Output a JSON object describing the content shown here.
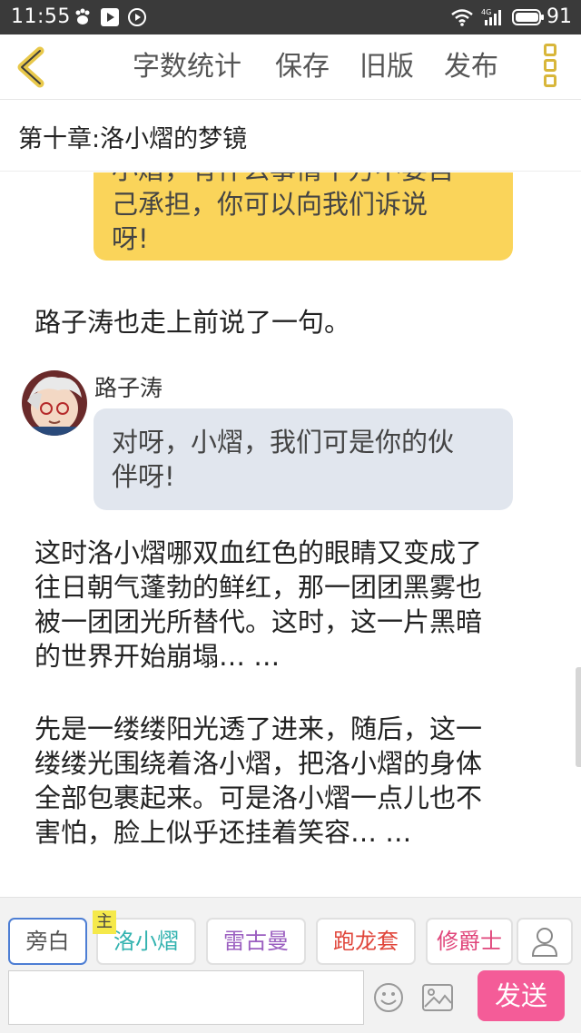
{
  "status_bar": {
    "time": "11:55",
    "network": "4G",
    "battery": "91"
  },
  "toolbar": {
    "word_count": "字数统计",
    "save": "保存",
    "old_version": "旧版",
    "publish": "发布"
  },
  "chapter": {
    "title": "第十章:洛小熠的梦镜"
  },
  "content": {
    "yellow_bubble": {
      "line1": "小熠，有什么事情千万不要自",
      "line2": "己承担，你可以向我们诉说",
      "line3": "呀!"
    },
    "para1": "路子涛也走上前说了一句。",
    "speaker": "路子涛",
    "grey_bubble": {
      "line1": "对呀，小熠，我们可是你的伙",
      "line2": "伴呀!"
    },
    "para2": {
      "line1": "这时洛小熠哪双血红色的眼睛又变成了",
      "line2": "往日朝气蓬勃的鲜红，那一团团黑雾也",
      "line3": "被一团团光所替代。这时，这一片黑暗",
      "line4": "的世界开始崩塌… …"
    },
    "para3": {
      "line1": "先是一缕缕阳光透了进来，随后，这一",
      "line2": "缕缕光围绕着洛小熠，把洛小熠的身体",
      "line3": "全部包裹起来。可是洛小熠一点儿也不",
      "line4": "害怕，脸上似乎还挂着笑容… …"
    }
  },
  "rolebar": {
    "roles": [
      {
        "label": "旁白",
        "color": "#555555"
      },
      {
        "label": "洛小熠",
        "color": "#33b3b0"
      },
      {
        "label": "雷古曼",
        "color": "#9b5fc0"
      },
      {
        "label": "跑龙套",
        "color": "#e0453a"
      },
      {
        "label": "修爵士",
        "color": "#e0457a"
      }
    ],
    "main_tag": "主",
    "send": "发送"
  },
  "colors": {
    "accent_yellow": "#fad45a",
    "send_pink": "#f45c98",
    "status_bar": "#3a3a3a"
  }
}
